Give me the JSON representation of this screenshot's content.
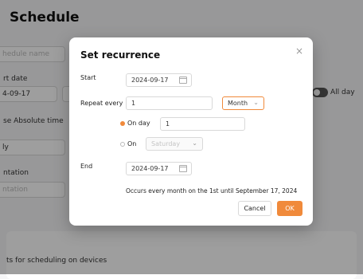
{
  "background": {
    "page_title": "Schedule",
    "schedule_name_placeholder": "hedule name",
    "start_date_label": "rt date",
    "start_date_value": "4-09-17",
    "use_absolute_time_label": "se Absolute time",
    "frequency_value": "ly",
    "orientation_label": "ntation",
    "orientation_placeholder": "ntation",
    "all_day_label": "All day",
    "devices_label": "ts for scheduling on devices"
  },
  "modal": {
    "title": "Set recurrence",
    "close_icon": "×",
    "start_label": "Start",
    "start_value": "2024-09-17",
    "repeat_every_label": "Repeat every",
    "repeat_every_value": "1",
    "repeat_unit": "Month",
    "on_day_label": "On day",
    "on_day_value": "1",
    "on_label": "On",
    "on_weekday_value": "Saturday",
    "end_label": "End",
    "end_value": "2024-09-17",
    "summary": "Occurs every month on the 1st until September 17, 2024",
    "cancel_label": "Cancel",
    "ok_label": "OK",
    "accent_color": "#f08a3b"
  }
}
